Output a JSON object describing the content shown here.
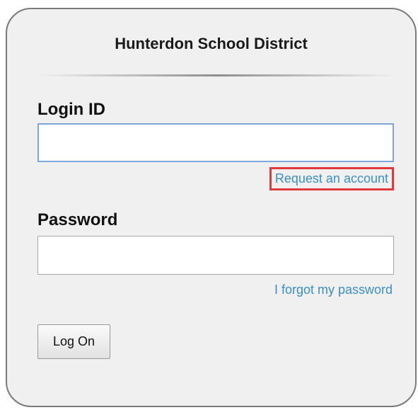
{
  "login": {
    "title": "Hunterdon School District",
    "login_id_label": "Login ID",
    "login_id_value": "",
    "request_account_link": "Request an account",
    "password_label": "Password",
    "password_value": "",
    "forgot_password_link": "I forgot my password",
    "logon_button": "Log On"
  },
  "colors": {
    "link": "#3a8fc4",
    "highlight_box": "#e0393e",
    "focus_border": "#7ea6d9",
    "panel_background": "#f0f0f0"
  }
}
